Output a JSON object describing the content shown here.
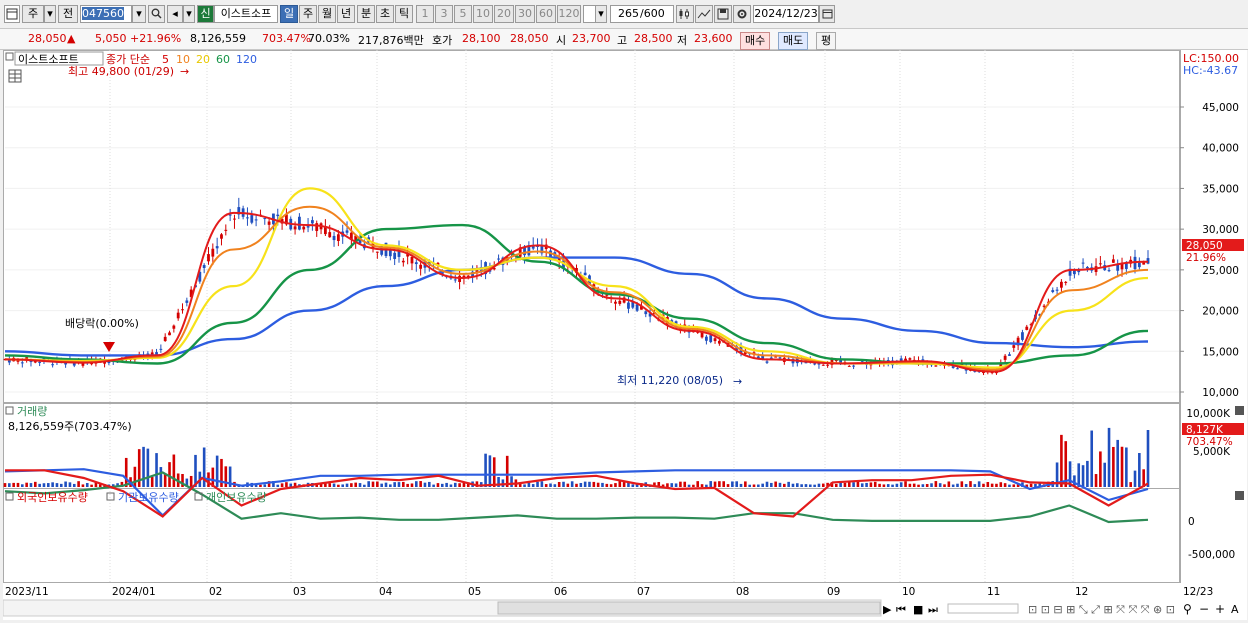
{
  "toolbar": {
    "market_tab": "주",
    "period_tab": "전",
    "stock_code": "047560",
    "new_badge": "신",
    "stock_name": "이스트소프",
    "timeframes": [
      "일",
      "주",
      "월",
      "년",
      "분",
      "초",
      "틱"
    ],
    "active_timeframe": "일",
    "intervals": [
      "1",
      "3",
      "5",
      "10",
      "20",
      "30",
      "60",
      "120"
    ],
    "data_count": "265",
    "data_total": "/600",
    "date": "2024/12/23"
  },
  "quote": {
    "price": "28,050",
    "change": "5,050",
    "change_pct": "+21.96%",
    "volume": "8,126,559",
    "volume_ratio": "703.47%",
    "turnover": "70.03%",
    "amount": "217,876백만",
    "bid_label": "호가",
    "bid": "28,100",
    "ask": "28,050",
    "open_label": "시",
    "open": "23,700",
    "high_label": "고",
    "high": "28,500",
    "low_label": "저",
    "low": "23,600",
    "buy_label": "매수",
    "sell_label": "매도",
    "avg_label": "평"
  },
  "price_panel": {
    "stock_tag": "이스트소프트",
    "ma_legend_title": "종가 단순",
    "ma_periods": [
      "5",
      "10",
      "20",
      "60",
      "120"
    ],
    "lc": "LC:150.00",
    "hc": "HC:-43.67",
    "high_note": "최고 49,800 (01/29)",
    "low_note": "최저 11,220 (08/05)",
    "dividend_note": "배당락(0.00%)",
    "y_ticks": [
      "45,000",
      "40,000",
      "35,000",
      "30,000",
      "25,000",
      "20,000",
      "15,000",
      "10,000"
    ],
    "last_price_tag": "28,050",
    "last_pct_tag": "21.96%"
  },
  "volume_panel": {
    "title": "거래량",
    "readout": "8,126,559주(703.47%)",
    "y_ticks": [
      "10,000K",
      "5,000K"
    ],
    "last_tag": "8,127K",
    "last_pct": "703.47%"
  },
  "holdings_panel": {
    "legend": [
      "외국인보유수량",
      "기관보유수량",
      "개인보유수량"
    ],
    "y_ticks": [
      "0",
      "-500,000"
    ]
  },
  "x_axis": {
    "labels": [
      "2023/11",
      "2024/01",
      "02",
      "03",
      "04",
      "05",
      "06",
      "07",
      "08",
      "09",
      "10",
      "11",
      "12",
      "12/23"
    ]
  },
  "colors": {
    "candle_up": "#d40000",
    "candle_down": "#1f4fbf",
    "ma5": "#e31b1b",
    "ma10": "#f0821e",
    "ma20": "#f7e21a",
    "ma60": "#169447",
    "ma120": "#2d5de0",
    "foreign": "#e31b1b",
    "institution": "#2d5de0",
    "individual": "#2e8b57"
  },
  "chart_data": {
    "type": "line",
    "title": "이스트소프트",
    "x": [
      "2023/11",
      "2024/01",
      "02",
      "03",
      "04",
      "05",
      "06",
      "07",
      "08",
      "09",
      "10",
      "11",
      "12",
      "12/23"
    ],
    "ylim": [
      10000,
      50000
    ],
    "series": [
      {
        "name": "5",
        "values": [
          14000,
          13600,
          14500,
          32000,
          30500,
          27500,
          24000,
          28000,
          21500,
          17500,
          14000,
          13500,
          13800,
          12500,
          25000,
          26000
        ]
      },
      {
        "name": "20",
        "values": [
          14000,
          13800,
          14200,
          23000,
          35000,
          28000,
          25000,
          26500,
          23000,
          18000,
          15000,
          13500,
          13500,
          13000,
          20000,
          24000
        ]
      },
      {
        "name": "60",
        "values": [
          14500,
          14000,
          13500,
          18500,
          25000,
          30000,
          30500,
          26000,
          22000,
          19000,
          16000,
          14000,
          13500,
          13500,
          14500,
          17500
        ]
      },
      {
        "name": "120",
        "values": [
          15000,
          14500,
          14500,
          16500,
          20000,
          23000,
          25000,
          26500,
          26500,
          24500,
          21500,
          19000,
          17500,
          16000,
          15500,
          16200
        ]
      }
    ],
    "annotations": [
      "최고 49,800 (01/29)",
      "최저 11,220 (08/05)",
      "배당락(0.00%)"
    ]
  }
}
